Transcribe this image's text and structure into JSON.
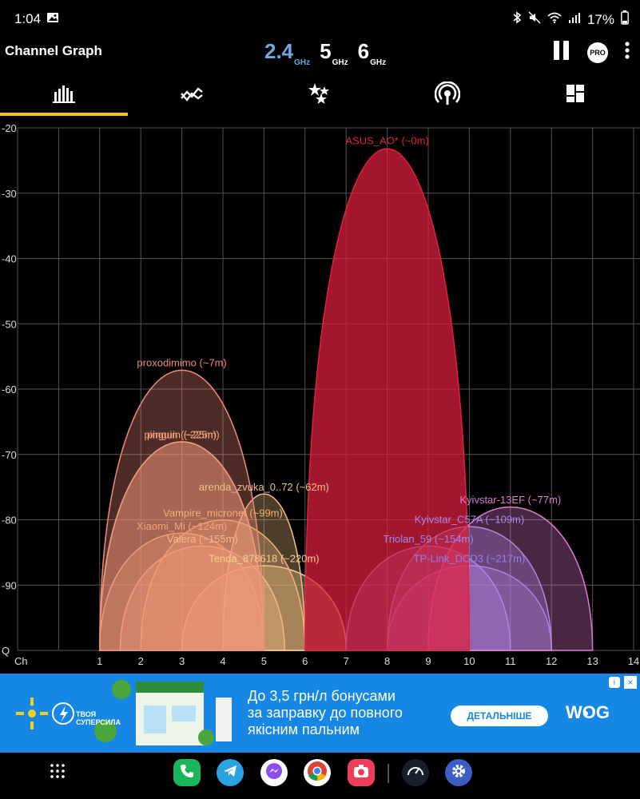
{
  "status_bar": {
    "time": "1:04",
    "battery": "17%"
  },
  "app_bar": {
    "title": "Channel Graph",
    "bands": [
      {
        "value": "2.4",
        "unit": "GHz",
        "active": true
      },
      {
        "value": "5",
        "unit": "GHz",
        "active": false
      },
      {
        "value": "6",
        "unit": "GHz",
        "active": false
      }
    ],
    "pro_label": "PRO"
  },
  "tabs": [
    "channel-graph",
    "time-graph",
    "channel-rating",
    "access-points",
    "vendors"
  ],
  "chart_data": {
    "type": "area",
    "y_tick_labels": [
      "-20",
      "-30",
      "-40",
      "-50",
      "-60",
      "-70",
      "-80",
      "-90",
      "Q"
    ],
    "x_axis_label": "Ch",
    "x_tick_labels": [
      "1",
      "2",
      "3",
      "4",
      "5",
      "6",
      "7",
      "8",
      "9",
      "10",
      "11",
      "12",
      "13",
      "14"
    ],
    "series": [
      {
        "label": "proxodimimo (~7m)",
        "center_channel": 3,
        "width_channels": 4,
        "signal_dbm": -57,
        "color": "#f08a7a"
      },
      {
        "label": "pinguin (~225m)",
        "center_channel": 3,
        "width_channels": 4,
        "signal_dbm": -68,
        "color": "#f5a07a"
      },
      {
        "label": "pinguin (~25m)",
        "center_channel": 3,
        "width_channels": 4,
        "signal_dbm": -68,
        "color": "#f5a07a"
      },
      {
        "label": "arenda_zvuka_0..72 (~62m)",
        "center_channel": 5,
        "width_channels": 2,
        "signal_dbm": -76,
        "color": "#f0c08a"
      },
      {
        "label": "Vampire_micronet (~99m)",
        "center_channel": 4,
        "width_channels": 4,
        "signal_dbm": -80,
        "color": "#f5b070"
      },
      {
        "label": "Xiaomi_Mi (~124m)",
        "center_channel": 3,
        "width_channels": 4,
        "signal_dbm": -82,
        "color": "#f5a47a"
      },
      {
        "label": "Valera (~155m)",
        "center_channel": 3.5,
        "width_channels": 4,
        "signal_dbm": -84,
        "color": "#f5b88a"
      },
      {
        "label": "Tenda_878618 (~220m)",
        "center_channel": 5,
        "width_channels": 4,
        "signal_dbm": -87,
        "color": "#f5d090"
      },
      {
        "label": "ASUS_AO* (~0m)",
        "center_channel": 8,
        "width_channels": 4,
        "signal_dbm": -23,
        "color": "#e0203f"
      },
      {
        "label": "Kyivstar-13EF (~77m)",
        "center_channel": 11,
        "width_channels": 4,
        "signal_dbm": -78,
        "color": "#e07ad0"
      },
      {
        "label": "Kyivstar_C57A (~109m)",
        "center_channel": 10,
        "width_channels": 4,
        "signal_dbm": -81,
        "color": "#a88af0"
      },
      {
        "label": "Triolan_59 (~154m)",
        "center_channel": 9,
        "width_channels": 4,
        "signal_dbm": -84,
        "color": "#9a8af5"
      },
      {
        "label": "TP-Link_DCD3 (~217m)",
        "center_channel": 10,
        "width_channels": 4,
        "signal_dbm": -87,
        "color": "#9080f0"
      }
    ]
  },
  "ad": {
    "brand_line1": "ТВОЯ",
    "brand_line2": "СУПЕРСИЛА",
    "text_line1": "До 3,5 грн/л бонусами",
    "text_line2": "за заправку до повного",
    "text_line3": "якісним пальним",
    "cta": "ДЕТАЛЬНІШЕ",
    "advertiser": "WOG"
  }
}
